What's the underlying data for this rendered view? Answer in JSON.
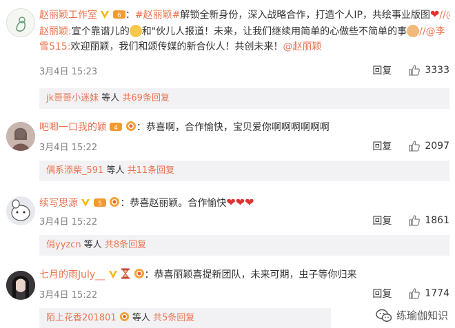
{
  "comments": [
    {
      "username": "赵丽颖工作室",
      "sep": "：",
      "hashtag": "#赵丽颖#",
      "text1": "解锁全新身份，深入战略合作，打造个人IP，共绘事业版图",
      "line2_mention": "//@赵丽颖:",
      "line2_text": "宣个靠谱儿的",
      "line2_text2": "和\"伙儿人报道！未来，让我们继续用简单的心做些不简单的事",
      "line2_mention2": "//@李雪515:",
      "line3_text": "欢迎丽颖，我们和颂传媒的新合伙人！共创未来！",
      "line3_mention": "@赵丽颖",
      "time": "3月4日 15:23",
      "reply_label": "回复",
      "likes": "3333",
      "sub": {
        "user": "jk哥哥小迷妹",
        "etc": " 等人 ",
        "more": "共69条回复"
      }
    },
    {
      "username": "吧唧一口我的颖",
      "sep": "：",
      "text1": "恭喜啊，合作愉快，宝贝爱你啊啊啊啊啊啊",
      "time": "3月4日 15:22",
      "reply_label": "回复",
      "likes": "2097",
      "sub": {
        "user": "偶系添柴_591",
        "etc": " 等人 ",
        "more": "共11条回复"
      }
    },
    {
      "username": "续写思源",
      "sep": "：",
      "text1": "恭喜赵丽颖。合作愉快",
      "time": "3月4日 15:22",
      "reply_label": "回复",
      "likes": "1861",
      "sub": {
        "user": "俏yyzcn",
        "etc": " 等人 ",
        "more": "共8条回复"
      }
    },
    {
      "username": "七月的雨July__",
      "sep": "：",
      "text1": "恭喜丽颖喜提新团队，未来可期，虫子等你归来",
      "time": "3月4日 15:22",
      "reply_label": "回复",
      "likes": "1774",
      "sub": {
        "user": "陌上花香201801",
        "etc": " 等人 ",
        "more": "共5条回复"
      }
    }
  ],
  "watermark": "练瑜伽知识",
  "colors": {
    "link": "#eb7350",
    "meta": "#808080",
    "subreply_bg": "#f2f2f5",
    "heart": "#e0332f"
  }
}
